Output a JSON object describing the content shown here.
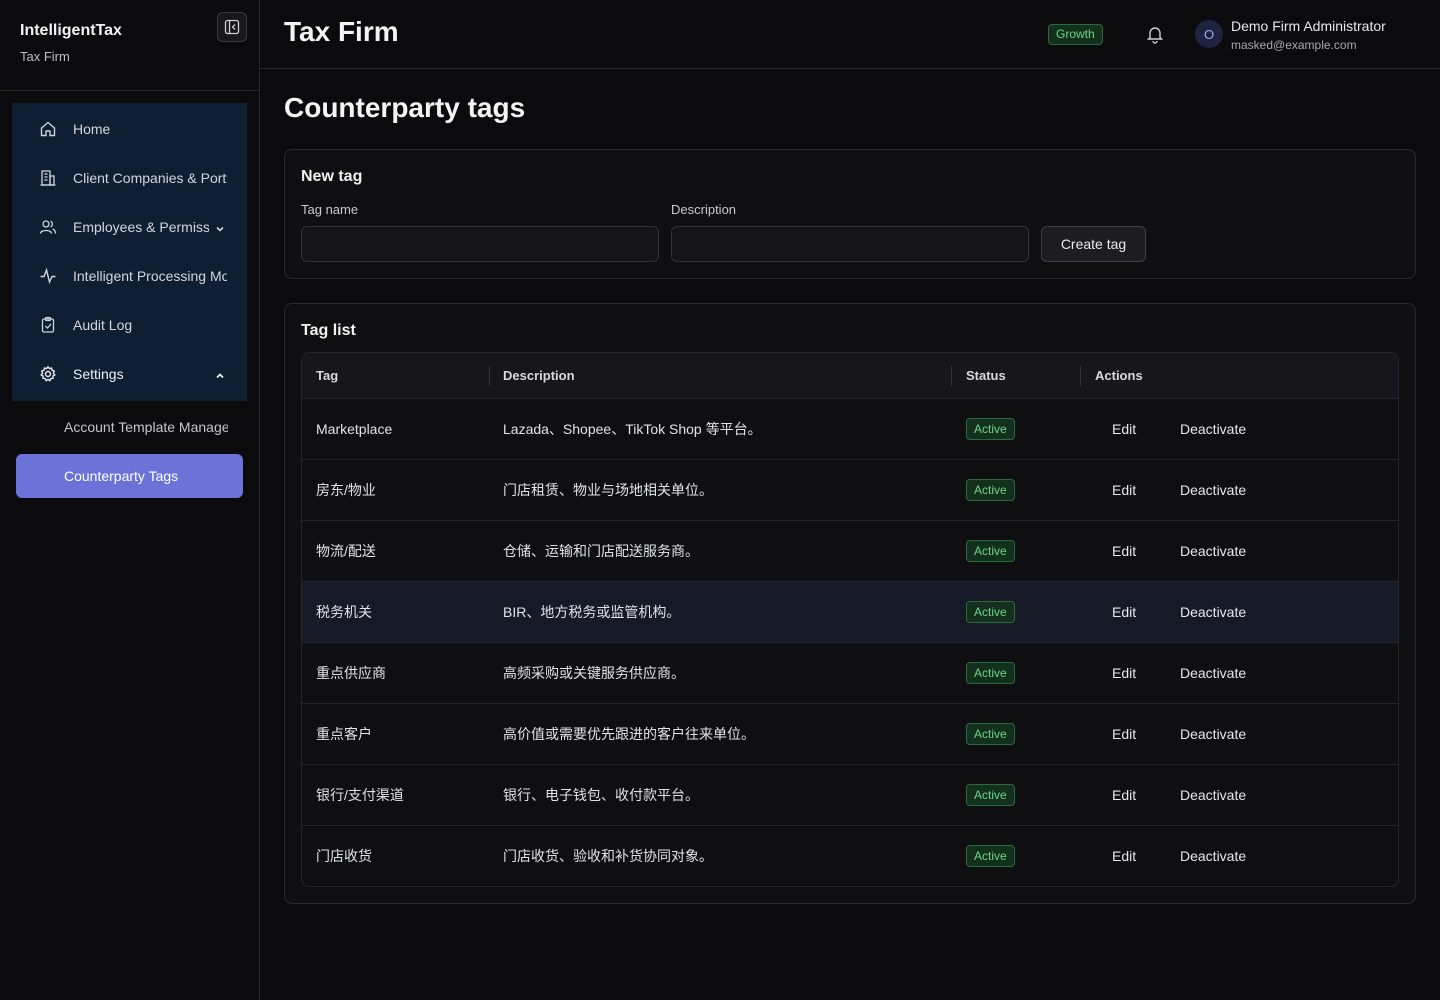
{
  "brand": {
    "name": "IntelligentTax",
    "firm": "Tax Firm"
  },
  "nav": {
    "items": [
      {
        "label": "Home",
        "icon": "home-icon"
      },
      {
        "label": "Client Companies & Portfolios",
        "icon": "building-icon"
      },
      {
        "label": "Employees & Permissions",
        "icon": "users-icon"
      },
      {
        "label": "Intelligent Processing Monitor",
        "icon": "activity-icon"
      },
      {
        "label": "Audit Log",
        "icon": "clipboard-icon"
      },
      {
        "label": "Settings",
        "icon": "gear-icon"
      }
    ],
    "settings_sub": [
      {
        "label": "Account Template Management"
      },
      {
        "label": "Counterparty Tags"
      }
    ]
  },
  "header": {
    "title": "Tax Firm",
    "plan": "Growth",
    "user": {
      "initial": "O",
      "name": "Demo Firm Administrator",
      "email": "masked@example.com"
    }
  },
  "page": {
    "title": "Counterparty tags"
  },
  "new_tag": {
    "title": "New tag",
    "tag_name_label": "Tag name",
    "tag_name_value": "",
    "description_label": "Description",
    "description_value": "",
    "create_label": "Create tag"
  },
  "tag_list": {
    "title": "Tag list",
    "columns": [
      "Tag",
      "Description",
      "Status",
      "Actions"
    ],
    "edit_label": "Edit",
    "deactivate_label": "Deactivate",
    "rows": [
      {
        "tag": "Marketplace",
        "description": "Lazada、Shopee、TikTok Shop 等平台。",
        "status": "Active"
      },
      {
        "tag": "房东/物业",
        "description": "门店租赁、物业与场地相关单位。",
        "status": "Active"
      },
      {
        "tag": "物流/配送",
        "description": "仓储、运输和门店配送服务商。",
        "status": "Active"
      },
      {
        "tag": "税务机关",
        "description": "BIR、地方税务或监管机构。",
        "status": "Active"
      },
      {
        "tag": "重点供应商",
        "description": "高频采购或关键服务供应商。",
        "status": "Active"
      },
      {
        "tag": "重点客户",
        "description": "高价值或需要优先跟进的客户往来单位。",
        "status": "Active"
      },
      {
        "tag": "银行/支付渠道",
        "description": "银行、电子钱包、收付款平台。",
        "status": "Active"
      },
      {
        "tag": "门店收货",
        "description": "门店收货、验收和补货协同对象。",
        "status": "Active"
      }
    ]
  }
}
